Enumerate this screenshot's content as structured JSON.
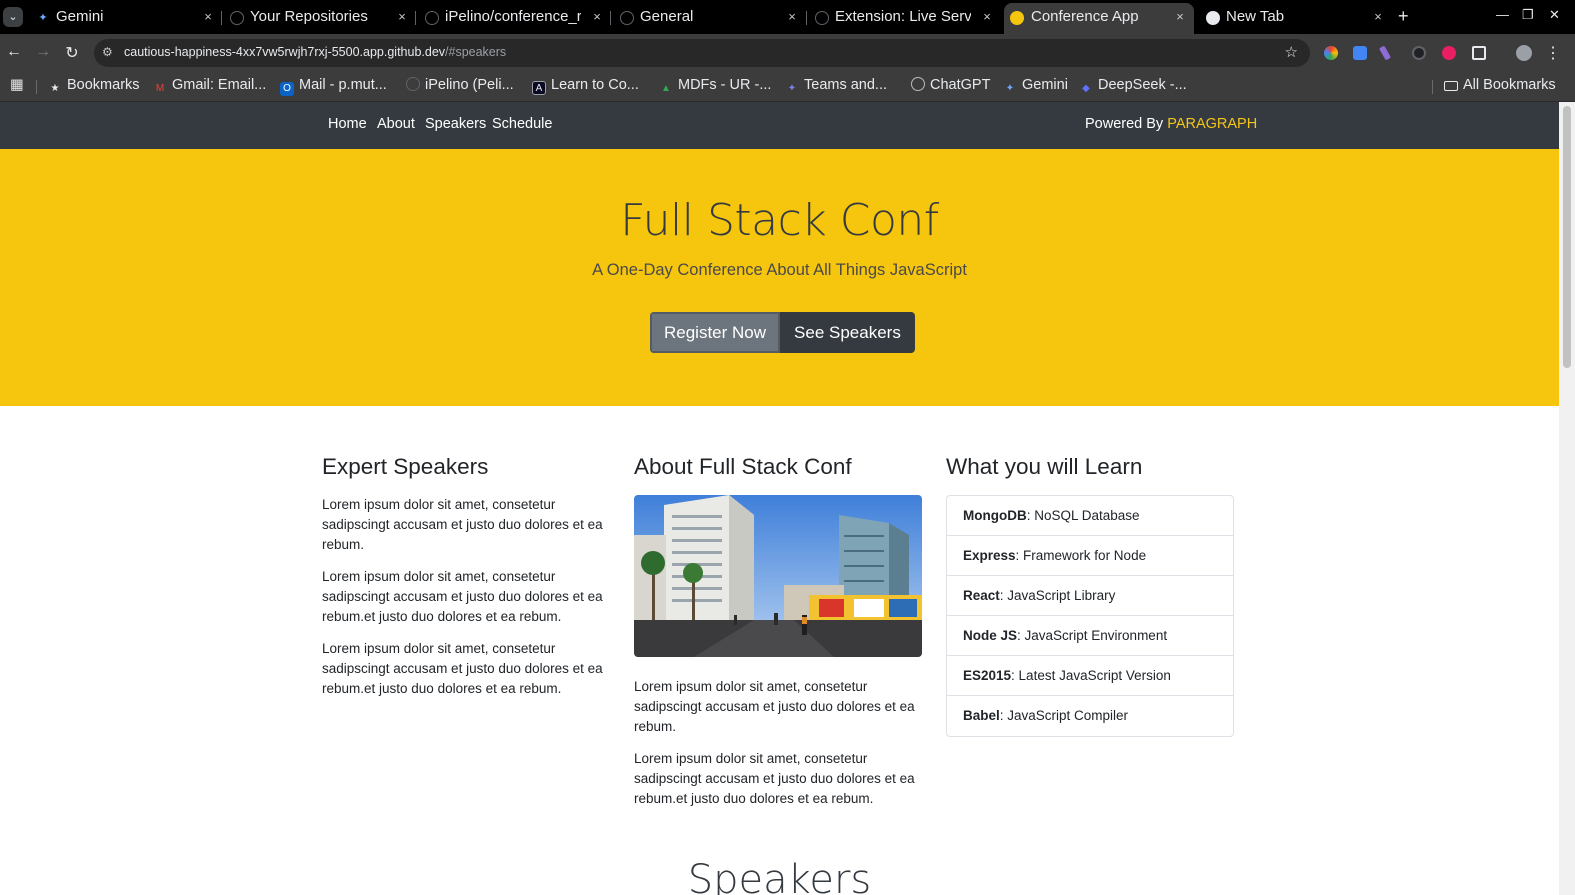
{
  "browser": {
    "tabs": [
      {
        "title": "Gemini",
        "close": "×"
      },
      {
        "title": "Your Repositories",
        "close": "×"
      },
      {
        "title": "iPelino/conference_r",
        "close": "×"
      },
      {
        "title": "General",
        "close": "×"
      },
      {
        "title": "Extension: Live Serve",
        "close": "×"
      },
      {
        "title": "Conference App",
        "close": "×",
        "active": true
      },
      {
        "title": "New Tab",
        "close": "×"
      }
    ],
    "new_tab": "+",
    "url_host": "cautious-happiness-4xx7vw5rwjh7rxj-5500.app.github.dev",
    "url_path": "/#speakers",
    "bookmarks": [
      {
        "label": "Bookmarks",
        "icon": "star-icon"
      },
      {
        "label": "Gmail: Email...",
        "icon": "gmail-icon"
      },
      {
        "label": "Mail - p.mut...",
        "icon": "outlook-icon"
      },
      {
        "label": "iPelino (Peli...",
        "icon": "github-icon"
      },
      {
        "label": "Learn to Co...",
        "icon": "code-icon"
      },
      {
        "label": "MDFs - UR -...",
        "icon": "drive-icon"
      },
      {
        "label": "Teams and...",
        "icon": "teams-icon"
      },
      {
        "label": "ChatGPT",
        "icon": "chatgpt-icon"
      },
      {
        "label": "Gemini",
        "icon": "gemini-icon"
      },
      {
        "label": "DeepSeek -...",
        "icon": "deepseek-icon"
      }
    ],
    "all_bookmarks": "All Bookmarks"
  },
  "site": {
    "nav": [
      "Home",
      "About",
      "Speakers",
      "Schedule"
    ],
    "powered_by": "Powered By",
    "brand": "PARAGRAPH",
    "hero": {
      "title": "Full Stack Conf",
      "subtitle": "A One-Day Conference About All Things JavaScript",
      "register": "Register Now",
      "see_speakers": "See Speakers"
    },
    "expert": {
      "heading": "Expert Speakers",
      "p1": "Lorem ipsum dolor sit amet, consetetur sadipscingt accusam et justo duo dolores et ea rebum.",
      "p2": "Lorem ipsum dolor sit amet, consetetur sadipscingt accusam et justo duo dolores et ea rebum.et justo duo dolores et ea rebum.",
      "p3": "Lorem ipsum dolor sit amet, consetetur sadipscingt accusam et justo duo dolores et ea rebum.et justo duo dolores et ea rebum."
    },
    "about": {
      "heading": "About Full Stack Conf",
      "p1": "Lorem ipsum dolor sit amet, consetetur sadipscingt accusam et justo duo dolores et ea rebum.",
      "p2": "Lorem ipsum dolor sit amet, consetetur sadipscingt accusam et justo duo dolores et ea rebum.et justo duo dolores et ea rebum."
    },
    "learn": {
      "heading": "What you will Learn",
      "items": [
        {
          "name": "MongoDB",
          "desc": ": NoSQL Database"
        },
        {
          "name": "Express",
          "desc": ": Framework for Node"
        },
        {
          "name": "React",
          "desc": ": JavaScript Library"
        },
        {
          "name": "Node JS",
          "desc": ": JavaScript Environment"
        },
        {
          "name": "ES2015",
          "desc": ": Latest JavaScript Version"
        },
        {
          "name": "Babel",
          "desc": ": JavaScript Compiler"
        }
      ]
    },
    "speakers_section": "Speakers"
  }
}
